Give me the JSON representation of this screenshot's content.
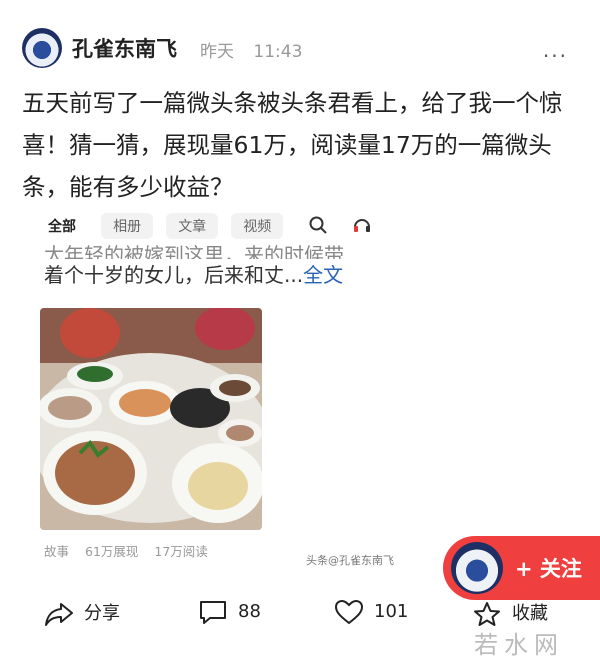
{
  "header": {
    "author": "孔雀东南飞",
    "date": "昨天",
    "time": "11:43",
    "more": "···"
  },
  "post": {
    "text": "五天前写了一篇微头条被头条君看上，给了我一个惊喜！猜一猜，展现量61万，阅读量17万的一篇微头条，能有多少收益？"
  },
  "card": {
    "tabs": [
      "全部",
      "相册",
      "文章",
      "视频"
    ],
    "excerpt_partial": "太年轻的被嫁到这里，来的时候带",
    "excerpt_line": "着个十岁的女儿，后来和丈...",
    "fulltext_link": "全文",
    "meta": {
      "category": "故事",
      "impressions": "61万展现",
      "reads": "17万阅读"
    },
    "watermark": "头条@孔雀东南飞"
  },
  "follow": {
    "label": "+ 关注"
  },
  "actions": {
    "share": "分享",
    "comments": "88",
    "likes": "101",
    "favorite": "收藏"
  },
  "brand": "若水网"
}
